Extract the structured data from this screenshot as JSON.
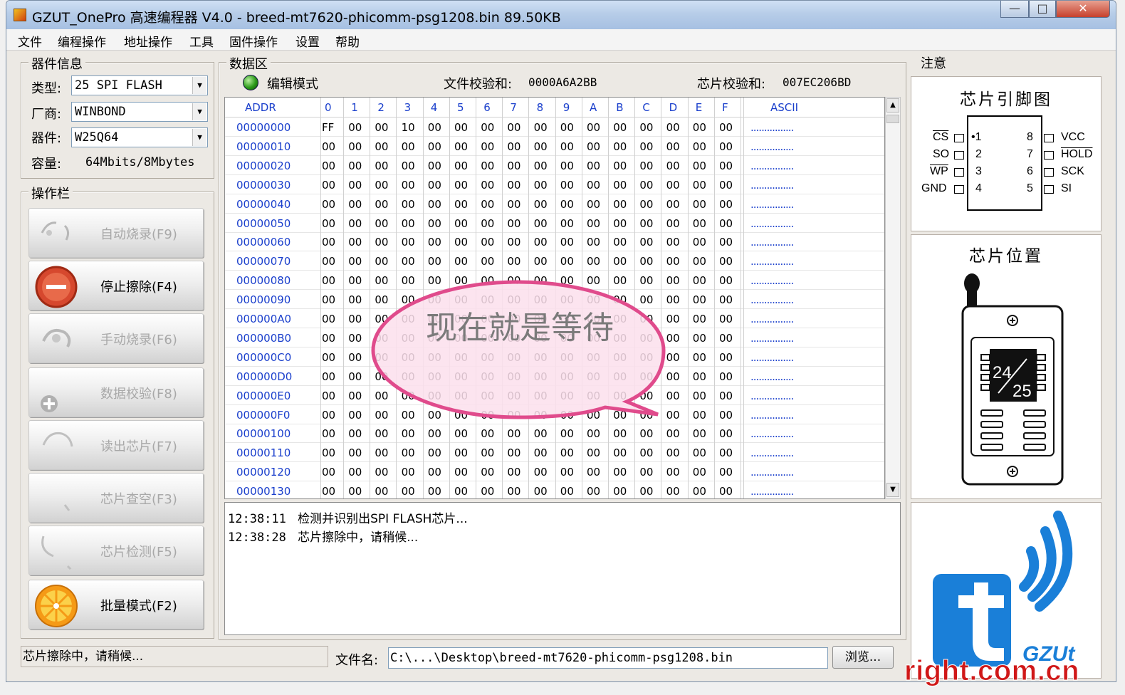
{
  "window": {
    "title": "GZUT_OnePro 高速编程器 V4.0 - breed-mt7620-phicomm-psg1208.bin  89.50KB",
    "minimize_label": "—",
    "maximize_label": "□",
    "close_label": "✕"
  },
  "menu": [
    "文件",
    "编程操作",
    "地址操作",
    "工具",
    "固件操作",
    "设置",
    "帮助"
  ],
  "device_info": {
    "group_title": "器件信息",
    "type_label": "类型:",
    "type_value": "25 SPI FLASH",
    "vendor_label": "厂商:",
    "vendor_value": "WINBOND",
    "device_label": "器件:",
    "device_value": "W25Q64",
    "capacity_label": "容量:",
    "capacity_value": "64Mbits/8Mbytes"
  },
  "operations": {
    "group_title": "操作栏",
    "buttons": [
      {
        "label": "自动烧录(F9)",
        "enabled": false
      },
      {
        "label": "停止擦除(F4)",
        "enabled": true
      },
      {
        "label": "手动烧录(F6)",
        "enabled": false
      },
      {
        "label": "数据校验(F8)",
        "enabled": false
      },
      {
        "label": "读出芯片(F7)",
        "enabled": false
      },
      {
        "label": "芯片查空(F3)",
        "enabled": false
      },
      {
        "label": "芯片检测(F5)",
        "enabled": false
      },
      {
        "label": "批量模式(F2)",
        "enabled": true
      }
    ]
  },
  "data_area": {
    "group_title": "数据区",
    "mode_label": "编辑模式",
    "file_checksum_label": "文件校验和:",
    "file_checksum_value": "0000A6A2BB",
    "chip_checksum_label": "芯片校验和:",
    "chip_checksum_value": "007EC206BD",
    "columns": [
      "ADDR",
      "0",
      "1",
      "2",
      "3",
      "4",
      "5",
      "6",
      "7",
      "8",
      "9",
      "A",
      "B",
      "C",
      "D",
      "E",
      "F",
      "ASCII"
    ],
    "rows": [
      {
        "addr": "00000000",
        "bytes": [
          "FF",
          "00",
          "00",
          "10",
          "00",
          "00",
          "00",
          "00",
          "00",
          "00",
          "00",
          "00",
          "00",
          "00",
          "00",
          "00"
        ],
        "ascii": "................"
      },
      {
        "addr": "00000010",
        "bytes": [
          "00",
          "00",
          "00",
          "00",
          "00",
          "00",
          "00",
          "00",
          "00",
          "00",
          "00",
          "00",
          "00",
          "00",
          "00",
          "00"
        ],
        "ascii": "................"
      },
      {
        "addr": "00000020",
        "bytes": [
          "00",
          "00",
          "00",
          "00",
          "00",
          "00",
          "00",
          "00",
          "00",
          "00",
          "00",
          "00",
          "00",
          "00",
          "00",
          "00"
        ],
        "ascii": "................"
      },
      {
        "addr": "00000030",
        "bytes": [
          "00",
          "00",
          "00",
          "00",
          "00",
          "00",
          "00",
          "00",
          "00",
          "00",
          "00",
          "00",
          "00",
          "00",
          "00",
          "00"
        ],
        "ascii": "................"
      },
      {
        "addr": "00000040",
        "bytes": [
          "00",
          "00",
          "00",
          "00",
          "00",
          "00",
          "00",
          "00",
          "00",
          "00",
          "00",
          "00",
          "00",
          "00",
          "00",
          "00"
        ],
        "ascii": "................"
      },
      {
        "addr": "00000050",
        "bytes": [
          "00",
          "00",
          "00",
          "00",
          "00",
          "00",
          "00",
          "00",
          "00",
          "00",
          "00",
          "00",
          "00",
          "00",
          "00",
          "00"
        ],
        "ascii": "................"
      },
      {
        "addr": "00000060",
        "bytes": [
          "00",
          "00",
          "00",
          "00",
          "00",
          "00",
          "00",
          "00",
          "00",
          "00",
          "00",
          "00",
          "00",
          "00",
          "00",
          "00"
        ],
        "ascii": "................"
      },
      {
        "addr": "00000070",
        "bytes": [
          "00",
          "00",
          "00",
          "00",
          "00",
          "00",
          "00",
          "00",
          "00",
          "00",
          "00",
          "00",
          "00",
          "00",
          "00",
          "00"
        ],
        "ascii": "................"
      },
      {
        "addr": "00000080",
        "bytes": [
          "00",
          "00",
          "00",
          "00",
          "00",
          "00",
          "00",
          "00",
          "00",
          "00",
          "00",
          "00",
          "00",
          "00",
          "00",
          "00"
        ],
        "ascii": "................"
      },
      {
        "addr": "00000090",
        "bytes": [
          "00",
          "00",
          "00",
          "00",
          "00",
          "00",
          "00",
          "00",
          "00",
          "00",
          "00",
          "00",
          "00",
          "00",
          "00",
          "00"
        ],
        "ascii": "................"
      },
      {
        "addr": "000000A0",
        "bytes": [
          "00",
          "00",
          "00",
          "00",
          "00",
          "00",
          "00",
          "00",
          "00",
          "00",
          "00",
          "00",
          "00",
          "00",
          "00",
          "00"
        ],
        "ascii": "................"
      },
      {
        "addr": "000000B0",
        "bytes": [
          "00",
          "00",
          "00",
          "00",
          "00",
          "00",
          "00",
          "00",
          "00",
          "00",
          "00",
          "00",
          "00",
          "00",
          "00",
          "00"
        ],
        "ascii": "................"
      },
      {
        "addr": "000000C0",
        "bytes": [
          "00",
          "00",
          "00",
          "00",
          "00",
          "00",
          "00",
          "00",
          "00",
          "00",
          "00",
          "00",
          "00",
          "00",
          "00",
          "00"
        ],
        "ascii": "................"
      },
      {
        "addr": "000000D0",
        "bytes": [
          "00",
          "00",
          "00",
          "00",
          "00",
          "00",
          "00",
          "00",
          "00",
          "00",
          "00",
          "00",
          "00",
          "00",
          "00",
          "00"
        ],
        "ascii": "................"
      },
      {
        "addr": "000000E0",
        "bytes": [
          "00",
          "00",
          "00",
          "00",
          "00",
          "00",
          "00",
          "00",
          "00",
          "00",
          "00",
          "00",
          "00",
          "00",
          "00",
          "00"
        ],
        "ascii": "................"
      },
      {
        "addr": "000000F0",
        "bytes": [
          "00",
          "00",
          "00",
          "00",
          "00",
          "00",
          "00",
          "00",
          "00",
          "00",
          "00",
          "00",
          "00",
          "00",
          "00",
          "00"
        ],
        "ascii": "................"
      },
      {
        "addr": "00000100",
        "bytes": [
          "00",
          "00",
          "00",
          "00",
          "00",
          "00",
          "00",
          "00",
          "00",
          "00",
          "00",
          "00",
          "00",
          "00",
          "00",
          "00"
        ],
        "ascii": "................"
      },
      {
        "addr": "00000110",
        "bytes": [
          "00",
          "00",
          "00",
          "00",
          "00",
          "00",
          "00",
          "00",
          "00",
          "00",
          "00",
          "00",
          "00",
          "00",
          "00",
          "00"
        ],
        "ascii": "................"
      },
      {
        "addr": "00000120",
        "bytes": [
          "00",
          "00",
          "00",
          "00",
          "00",
          "00",
          "00",
          "00",
          "00",
          "00",
          "00",
          "00",
          "00",
          "00",
          "00",
          "00"
        ],
        "ascii": "................"
      },
      {
        "addr": "00000130",
        "bytes": [
          "00",
          "00",
          "00",
          "00",
          "00",
          "00",
          "00",
          "00",
          "00",
          "00",
          "00",
          "00",
          "00",
          "00",
          "00",
          "00"
        ],
        "ascii": "................"
      }
    ]
  },
  "log": [
    {
      "time": "12:38:11",
      "message": "检测并识别出SPI FLASH芯片..."
    },
    {
      "time": "12:38:28",
      "message": "芯片擦除中，请稍候..."
    }
  ],
  "status": {
    "text": "芯片擦除中，请稍候...",
    "file_label": "文件名:",
    "file_path": "C:\\...\\Desktop\\breed-mt7620-phicomm-psg1208.bin",
    "browse_label": "浏览..."
  },
  "notes_panel": {
    "group_title": "注意",
    "pinout_title": "芯片引脚图",
    "pins_left": [
      {
        "num": "•1",
        "name": "CS"
      },
      {
        "num": "2",
        "name": "SO"
      },
      {
        "num": "3",
        "name": "WP"
      },
      {
        "num": "4",
        "name": "GND"
      }
    ],
    "pins_right": [
      {
        "num": "8",
        "name": "VCC"
      },
      {
        "num": "7",
        "name": "HOLD"
      },
      {
        "num": "6",
        "name": "SCK"
      },
      {
        "num": "5",
        "name": "SI"
      }
    ],
    "position_title": "芯片位置",
    "chip_label_top": "24",
    "chip_label_bottom": "25"
  },
  "overlay": {
    "bubble_text": "现在就是等待",
    "logo_text": "GZUt",
    "watermark": "right.com.cn"
  },
  "colors": {
    "hex_text_blue": "#1a3fcc",
    "bubble_fill": "#fce0ec",
    "bubble_stroke": "#e04b8c",
    "logo_blue": "#1a7fd8",
    "watermark_red": "#d01818"
  }
}
